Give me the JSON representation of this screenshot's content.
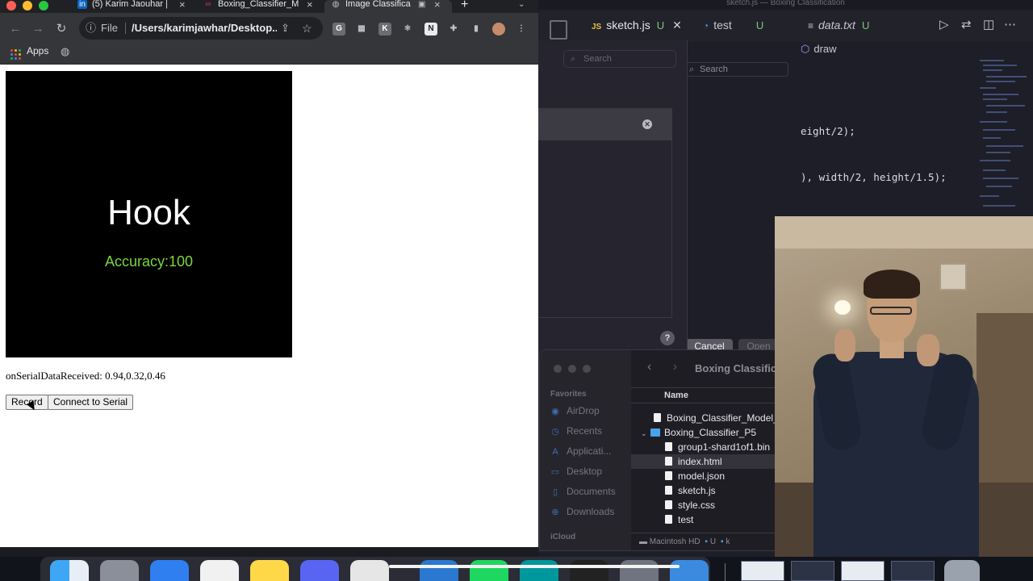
{
  "browser": {
    "tabs": [
      {
        "label": "(5) Karim Jaouhar | ",
        "icon": "linkedin-icon"
      },
      {
        "label": "Boxing_Classifier_M",
        "icon": "p5-icon"
      },
      {
        "label": "Image Classifica",
        "icon": "globe-icon"
      }
    ],
    "url_scheme": "File",
    "url": "/Users/karimjawhar/Desktop...",
    "bookmarks": {
      "apps_label": "Apps"
    }
  },
  "page": {
    "prediction_label": "Hook",
    "accuracy_text": "Accuracy:100",
    "serial_text": "onSerialDataReceived: 0.94,0.32,0.46",
    "buttons": {
      "record": "Record",
      "connect": "Connect to Serial"
    }
  },
  "vscode": {
    "title": "sketch.js — Boxing Classification",
    "tabs": [
      {
        "lang": "JS",
        "label": "sketch.js",
        "status": "U"
      },
      {
        "label": "test",
        "status": "U"
      },
      {
        "label": "data.txt",
        "status": "U"
      }
    ],
    "breadcrumb": "draw",
    "code_lines": [
      "eight/2);",
      "), width/2, height/1.5);"
    ]
  },
  "file_dialog": {
    "search_placeholder": "Search",
    "search2_placeholder": "Search",
    "cancel_label": "Cancel",
    "open_label": "Open",
    "help_label": "?"
  },
  "finder": {
    "title": "Boxing Classific",
    "sections": {
      "favorites": "Favorites",
      "icloud": "iCloud"
    },
    "favorites": [
      "AirDrop",
      "Recents",
      "Applicati...",
      "Desktop",
      "Documents",
      "Downloads"
    ],
    "column_header": "Name",
    "rows": [
      {
        "name": "Boxing_Classifier_Model_",
        "kind": "file"
      },
      {
        "name": "Boxing_Classifier_P5",
        "kind": "folder"
      },
      {
        "name": "group1-shard1of1.bin",
        "kind": "file"
      },
      {
        "name": "index.html",
        "kind": "file"
      },
      {
        "name": "model.json",
        "kind": "file"
      },
      {
        "name": "sketch.js",
        "kind": "file"
      },
      {
        "name": "style.css",
        "kind": "file"
      },
      {
        "name": "test",
        "kind": "file"
      }
    ],
    "path": {
      "root": "Macintosh HD",
      "seg1": "U",
      "seg2": "k"
    }
  },
  "colors": {
    "accuracy": "#7cd63a",
    "canvas_bg": "#000000",
    "finder_folder": "#4aa3e8",
    "vscode_modified": "#7fc67a"
  }
}
